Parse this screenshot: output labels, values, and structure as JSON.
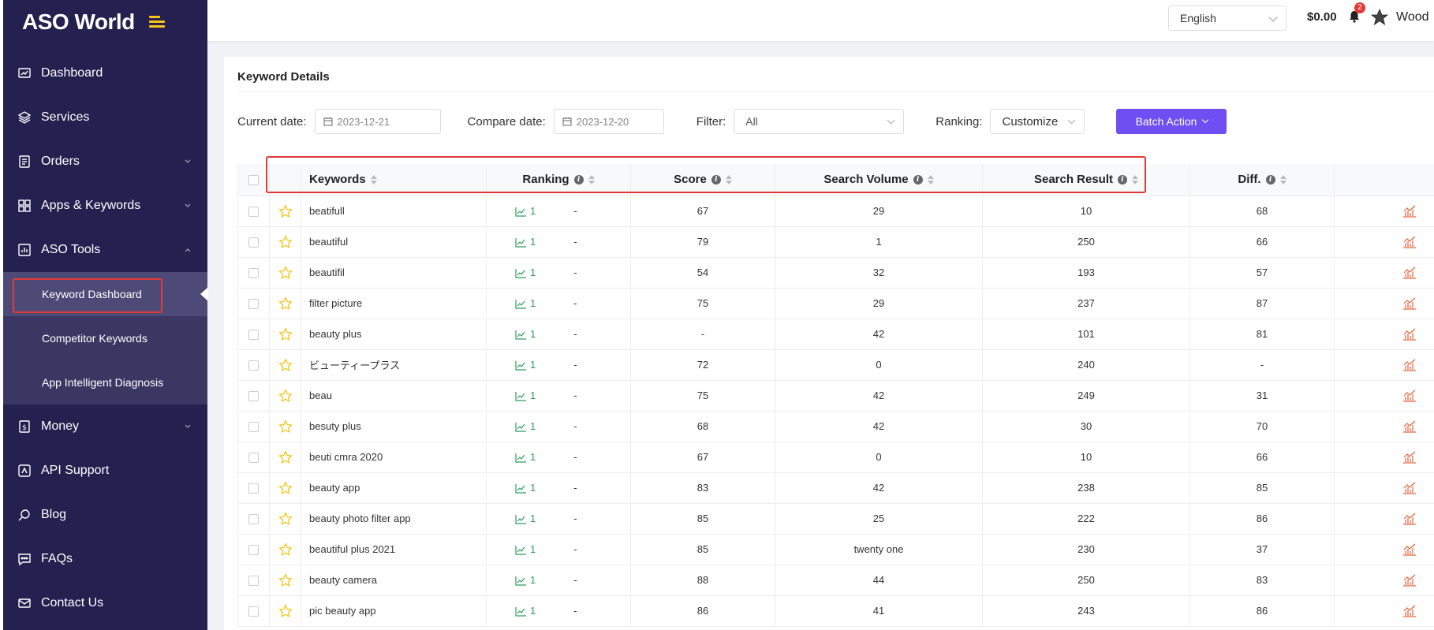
{
  "app": {
    "logo_text": "ASO World"
  },
  "sidebar": {
    "items": [
      {
        "label": "Dashboard",
        "icon": "dashboard-icon"
      },
      {
        "label": "Services",
        "icon": "layers-icon"
      },
      {
        "label": "Orders",
        "icon": "orders-icon",
        "has_chevron": true
      },
      {
        "label": "Apps & Keywords",
        "icon": "grid-icon",
        "has_chevron": true
      },
      {
        "label": "ASO Tools",
        "icon": "chart-icon",
        "expanded": true
      }
    ],
    "sub_items": [
      {
        "label": "Keyword Dashboard",
        "active": true
      },
      {
        "label": "Competitor Keywords"
      },
      {
        "label": "App Intelligent Diagnosis"
      }
    ],
    "items_after": [
      {
        "label": "Money",
        "icon": "money-icon",
        "has_chevron": true
      },
      {
        "label": "API Support",
        "icon": "api-icon"
      },
      {
        "label": "Blog",
        "icon": "blog-icon"
      },
      {
        "label": "FAQs",
        "icon": "faq-icon"
      },
      {
        "label": "Contact Us",
        "icon": "mail-icon"
      }
    ]
  },
  "header": {
    "language": "English",
    "balance": "$0.00",
    "notification_count": "2",
    "username": "Wood"
  },
  "main": {
    "title": "Keyword Details",
    "filters": {
      "current_date_label": "Current date:",
      "current_date": "2023-12-21",
      "compare_date_label": "Compare date:",
      "compare_date": "2023-12-20",
      "filter_label": "Filter:",
      "filter_value": "All",
      "ranking_label": "Ranking:",
      "ranking_value": "Customize",
      "batch_action": "Batch Action"
    },
    "table": {
      "columns": [
        "Keywords",
        "Ranking",
        "Score",
        "Search Volume",
        "Search Result",
        "Diff."
      ],
      "rows": [
        {
          "keyword": "beatifull",
          "rank": "1",
          "change": "-",
          "score": "67",
          "volume": "29",
          "result": "10",
          "diff": "68"
        },
        {
          "keyword": "beautiful",
          "rank": "1",
          "change": "-",
          "score": "79",
          "volume": "1",
          "result": "250",
          "diff": "66"
        },
        {
          "keyword": "beautifil",
          "rank": "1",
          "change": "-",
          "score": "54",
          "volume": "32",
          "result": "193",
          "diff": "57"
        },
        {
          "keyword": "filter picture",
          "rank": "1",
          "change": "-",
          "score": "75",
          "volume": "29",
          "result": "237",
          "diff": "87"
        },
        {
          "keyword": "beauty plus",
          "rank": "1",
          "change": "-",
          "score": "-",
          "volume": "42",
          "result": "101",
          "diff": "81"
        },
        {
          "keyword": "ビューティープラス",
          "rank": "1",
          "change": "-",
          "score": "72",
          "volume": "0",
          "result": "240",
          "diff": "-"
        },
        {
          "keyword": "beau",
          "rank": "1",
          "change": "-",
          "score": "75",
          "volume": "42",
          "result": "249",
          "diff": "31"
        },
        {
          "keyword": "besuty plus",
          "rank": "1",
          "change": "-",
          "score": "68",
          "volume": "42",
          "result": "30",
          "diff": "70"
        },
        {
          "keyword": "beuti cmra 2020",
          "rank": "1",
          "change": "-",
          "score": "67",
          "volume": "0",
          "result": "10",
          "diff": "66"
        },
        {
          "keyword": "beauty app",
          "rank": "1",
          "change": "-",
          "score": "83",
          "volume": "42",
          "result": "238",
          "diff": "85"
        },
        {
          "keyword": "beauty photo filter app",
          "rank": "1",
          "change": "-",
          "score": "85",
          "volume": "25",
          "result": "222",
          "diff": "86"
        },
        {
          "keyword": "beautiful plus 2021",
          "rank": "1",
          "change": "-",
          "score": "85",
          "volume": "twenty one",
          "result": "230",
          "diff": "37"
        },
        {
          "keyword": "beauty camera",
          "rank": "1",
          "change": "-",
          "score": "88",
          "volume": "44",
          "result": "250",
          "diff": "83"
        },
        {
          "keyword": "pic beauty app",
          "rank": "1",
          "change": "-",
          "score": "86",
          "volume": "41",
          "result": "243",
          "diff": "86"
        }
      ]
    }
  },
  "colors": {
    "sidebar_bg": "#24204f",
    "accent": "#6f4ef2",
    "highlight": "#e53935",
    "rank_green": "#2e9d5b",
    "star_yellow": "#f5c518",
    "trend_orange": "#e8613a"
  }
}
